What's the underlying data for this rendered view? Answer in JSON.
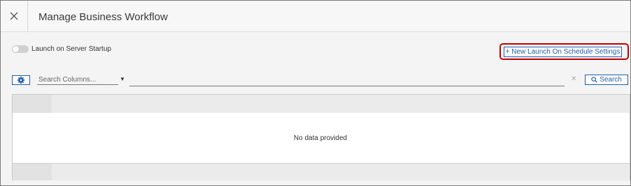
{
  "header": {
    "title": "Manage Business Workflow",
    "close_icon": "close-icon"
  },
  "toolbar": {
    "toggle_label": "Launch on Server Startup",
    "toggle_on": false,
    "new_button_label": "+ New Launch On Schedule Settings",
    "highlight_color": "#c00000",
    "accent_color": "#1f5fa8"
  },
  "search": {
    "gear_icon": "gear-icon",
    "columns_placeholder": "Search Columns...",
    "columns_dropdown_icon": "caret-down-icon",
    "query_value": "",
    "clear_icon": "clear-icon",
    "search_button_label": "Search",
    "search_icon": "search-icon"
  },
  "grid": {
    "empty_message": "No data provided"
  }
}
